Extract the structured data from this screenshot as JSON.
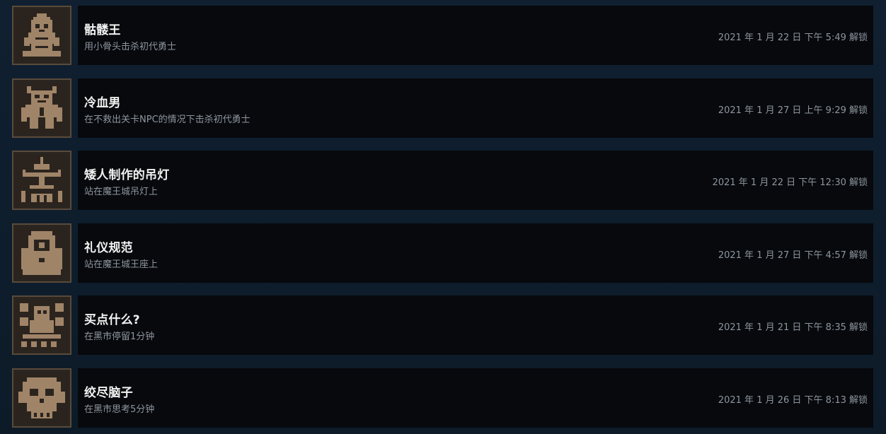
{
  "achievements": [
    {
      "title": "骷髅王",
      "description": "用小骨头击杀初代勇士",
      "unlock_time": "2021 年 1 月 22 日 下午 5:49 解锁",
      "icon": "skeleton-king-icon"
    },
    {
      "title": "冷血男",
      "description": "在不救出关卡NPC的情况下击杀初代勇士",
      "unlock_time": "2021 年 1 月 27 日 上午 9:29 解锁",
      "icon": "cold-blooded-icon"
    },
    {
      "title": "矮人制作的吊灯",
      "description": "站在魔王城吊灯上",
      "unlock_time": "2021 年 1 月 22 日 下午 12:30 解锁",
      "icon": "chandelier-icon"
    },
    {
      "title": "礼仪规范",
      "description": "站在魔王城王座上",
      "unlock_time": "2021 年 1 月 27 日 下午 4:57 解锁",
      "icon": "throne-icon"
    },
    {
      "title": "买点什么?",
      "description": "在黑市停留1分钟",
      "unlock_time": "2021 年 1 月 21 日 下午 8:35 解锁",
      "icon": "black-market-icon"
    },
    {
      "title": "绞尽脑子",
      "description": "在黑市思考5分钟",
      "unlock_time": "2021 年 1 月 26 日 下午 8:13 解锁",
      "icon": "thinking-skull-icon"
    }
  ],
  "colors": {
    "background": "#0e1a27",
    "panel": "#07090d",
    "title": "#f2f2f2",
    "secondary_text": "#8e969e",
    "icon_frame": "#5a4a3a",
    "icon_tint": "#a08468"
  }
}
